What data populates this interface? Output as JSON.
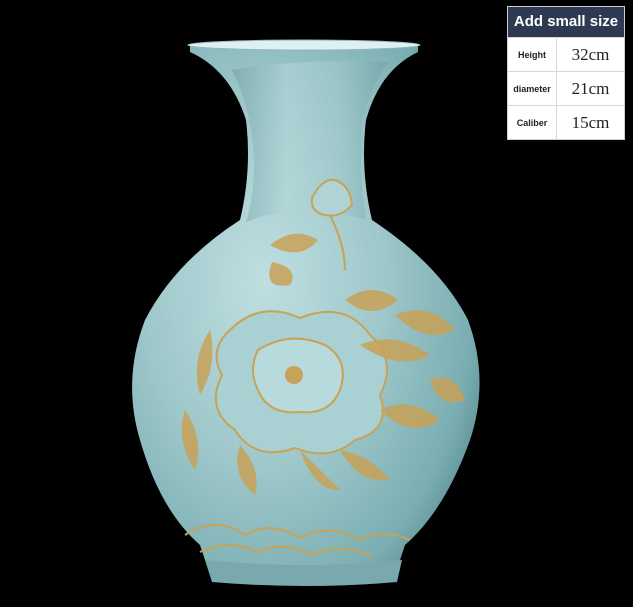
{
  "size_panel": {
    "title": "Add small size",
    "rows": [
      {
        "label": "Height",
        "value": "32cm"
      },
      {
        "label": "diameter",
        "value": "21cm"
      },
      {
        "label": "Caliber",
        "value": "15cm"
      }
    ]
  },
  "colors": {
    "background": "#000000",
    "glaze": "#9cc6c9",
    "gold": "#c8a257",
    "panel_header": "#2e3a52"
  }
}
